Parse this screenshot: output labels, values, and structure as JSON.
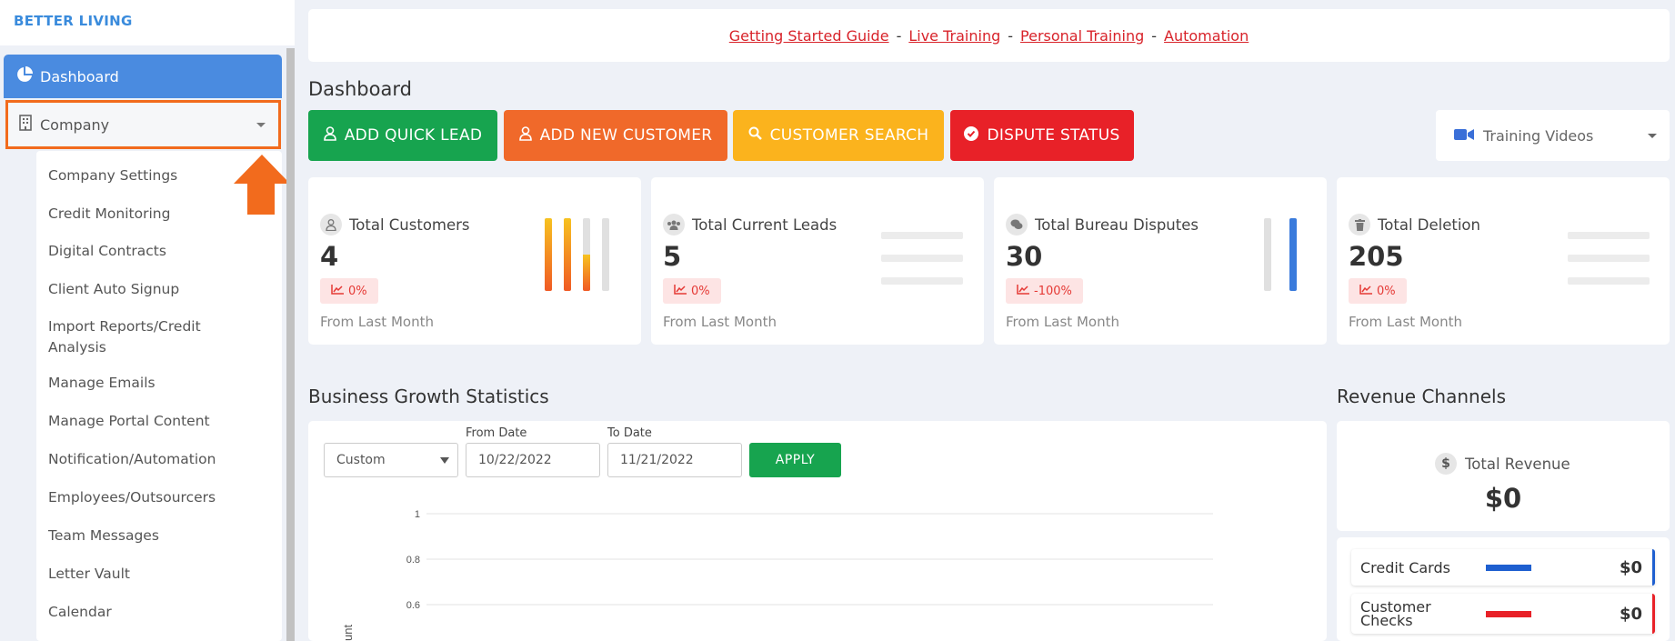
{
  "brand": "BETTER LIVING",
  "sidebar": {
    "dashboard": "Dashboard",
    "company": "Company",
    "submenu": [
      "Company Settings",
      "Credit Monitoring",
      "Digital Contracts",
      "Client Auto Signup",
      "Import Reports/Credit Analysis",
      "Manage Emails",
      "Manage Portal Content",
      "Notification/Automation",
      "Employees/Outsourcers",
      "Team Messages",
      "Letter Vault",
      "Calendar"
    ]
  },
  "banner": {
    "links": [
      "Getting Started Guide",
      "Live Training",
      "Personal Training",
      "Automation"
    ],
    "separator": "-"
  },
  "page_title": "Dashboard",
  "actions": {
    "quick_lead": "ADD QUICK LEAD",
    "new_customer": "ADD NEW CUSTOMER",
    "customer_search": "CUSTOMER SEARCH",
    "dispute_status": "DISPUTE STATUS"
  },
  "training_videos": "Training Videos",
  "stats": [
    {
      "label": "Total Customers",
      "value": "4",
      "change": "0%",
      "foot": "From Last Month"
    },
    {
      "label": "Total Current Leads",
      "value": "5",
      "change": "0%",
      "foot": "From Last Month"
    },
    {
      "label": "Total Bureau Disputes",
      "value": "30",
      "change": "-100%",
      "foot": "From Last Month"
    },
    {
      "label": "Total Deletion",
      "value": "205",
      "change": "0%",
      "foot": "From Last Month"
    }
  ],
  "mini_bars": {
    "customers": [
      1.0,
      1.0,
      0.5,
      0.0
    ],
    "disputes": [
      0.0,
      1.0
    ]
  },
  "growth": {
    "title": "Business Growth Statistics",
    "range_select": "Custom",
    "from_label": "From Date",
    "from_value": "10/22/2022",
    "to_label": "To Date",
    "to_value": "11/21/2022",
    "apply": "APPLY"
  },
  "chart_data": {
    "type": "line",
    "y_ticks": [
      "1",
      "0.8",
      "0.6"
    ],
    "ylabel": "unt",
    "grid": true
  },
  "revenue": {
    "title": "Revenue Channels",
    "total_label": "Total Revenue",
    "total": "$0",
    "channels": [
      {
        "name": "Credit Cards",
        "amount": "$0",
        "color": "#1e5fd0"
      },
      {
        "name": "Customer Checks",
        "amount": "$0",
        "color": "#e82128"
      }
    ]
  },
  "colors": {
    "primary_blue": "#4a8be0",
    "highlight_orange": "#f26b1d",
    "green": "#17a44f",
    "orange": "#f0692a",
    "yellow": "#fbb31d",
    "red": "#e82128"
  }
}
